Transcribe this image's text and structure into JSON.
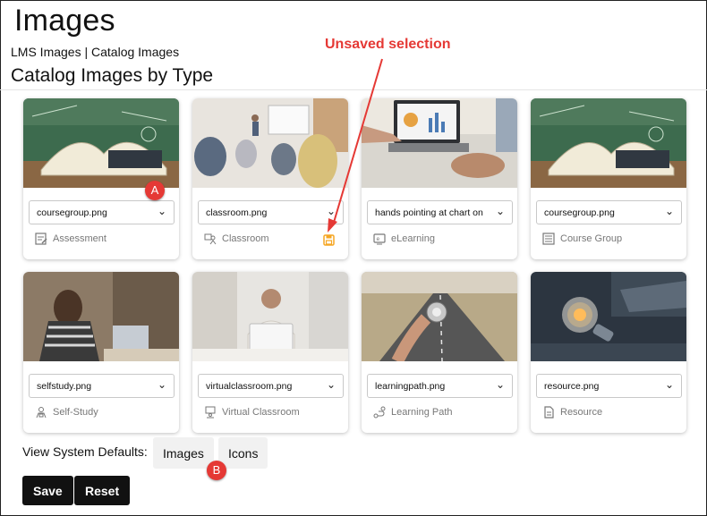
{
  "page": {
    "title": "Images",
    "breadcrumb": {
      "lms": "LMS Images",
      "sep": "|",
      "catalog": "Catalog Images"
    },
    "section_title": "Catalog Images by Type"
  },
  "annotation": {
    "text": "Unsaved selection",
    "color": "#e53935"
  },
  "callouts": {
    "a": "A",
    "b": "B"
  },
  "cards": [
    {
      "image": "coursegroup.png",
      "type": "Assessment",
      "icon": "assessment-icon",
      "unsaved": false
    },
    {
      "image": "classroom.png",
      "type": "Classroom",
      "icon": "classroom-icon",
      "unsaved": true
    },
    {
      "image": "hands pointing at chart on",
      "type": "eLearning",
      "icon": "elearning-icon",
      "unsaved": false
    },
    {
      "image": "coursegroup.png",
      "type": "Course Group",
      "icon": "course-group-icon",
      "unsaved": false
    },
    {
      "image": "selfstudy.png",
      "type": "Self-Study",
      "icon": "self-study-icon",
      "unsaved": false
    },
    {
      "image": "virtualclassroom.png",
      "type": "Virtual Classroom",
      "icon": "virtual-classroom-icon",
      "unsaved": false
    },
    {
      "image": "learningpath.png",
      "type": "Learning Path",
      "icon": "learning-path-icon",
      "unsaved": false
    },
    {
      "image": "resource.png",
      "type": "Resource",
      "icon": "resource-icon",
      "unsaved": false
    }
  ],
  "system_defaults": {
    "label": "View System Defaults:",
    "images": "Images",
    "icons": "Icons"
  },
  "actions": {
    "save": "Save",
    "reset": "Reset"
  },
  "colors": {
    "save_icon": "#f5a623",
    "button_dark": "#111111",
    "accent_red": "#e53935"
  }
}
